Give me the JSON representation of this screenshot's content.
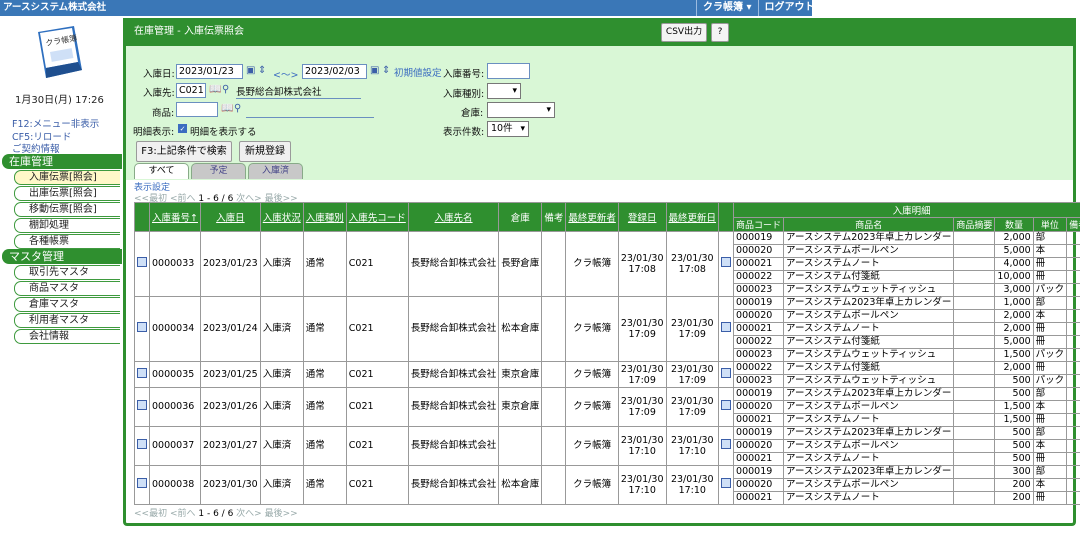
{
  "company": "アースシステム株式会社",
  "topmenu": [
    "クラ帳簿 ▾",
    "ログアウト"
  ],
  "logo_text": "クラ帳簿",
  "date": "1月30日(月) 17:26",
  "side_links": [
    "F12:メニュー非表示",
    "CF5:リロード",
    "ご契約情報"
  ],
  "sections": [
    {
      "label": "在庫管理",
      "items": [
        "入庫伝票[照会]",
        "出庫伝票[照会]",
        "移動伝票[照会]",
        "棚卸処理",
        "各種帳票"
      ]
    },
    {
      "label": "マスタ管理",
      "items": [
        "取引先マスタ",
        "商品マスタ",
        "倉庫マスタ",
        "利用者マスタ",
        "会社情報"
      ]
    }
  ],
  "panel": {
    "title": "在庫管理 - 入庫伝票照会",
    "csv": "CSV出力",
    "help": "?"
  },
  "form": {
    "date_label": "入庫日:",
    "date_from": "2023/01/23",
    "tilde": "<～>",
    "date_to": "2023/02/03",
    "init": "初期値設定",
    "slip_label": "入庫番号:",
    "supplier_label": "入庫先:",
    "supplier_code": "C021",
    "supplier_name": "長野総合卸株式会社",
    "type_label": "入庫種別:",
    "item_label": "商品:",
    "wh_label": "倉庫:",
    "detail_label": "明細表示:",
    "detail_check": "明細を表示する",
    "count_label": "表示件数:",
    "count_value": "10件",
    "search_btn": "F3:上記条件で検索",
    "new_btn": "新規登録"
  },
  "tabs": [
    "すべて",
    "予定",
    "入庫済"
  ],
  "showset": "表示設定",
  "pager": {
    "first": "<<最初",
    "prev": "<前へ",
    "range": "1 - 6 / 6",
    "next": "次へ>",
    "last": "最後>>"
  },
  "headers": [
    "入庫番号↑",
    "入庫日",
    "入庫状況",
    "入庫種別",
    "入庫先コード",
    "入庫先名",
    "倉庫",
    "備考",
    "最終更新者",
    "登録日",
    "最終更新日"
  ],
  "detail_header": "入庫明細",
  "detail_cols": [
    "商品コード",
    "商品名",
    "商品摘要",
    "数量",
    "単位",
    "備考"
  ],
  "rows": [
    {
      "no": "0000033",
      "date": "2023/01/23",
      "status": "入庫済",
      "type": "通常",
      "code": "C021",
      "name": "長野総合卸株式会社",
      "wh": "長野倉庫",
      "user": "クラ帳簿",
      "reg": "23/01/30 17:08",
      "upd": "23/01/30 17:08",
      "items": [
        [
          "000019",
          "アースシステム2023年卓上カレンダー",
          "2,000",
          "部"
        ],
        [
          "000020",
          "アースシステムボールペン",
          "5,000",
          "本"
        ],
        [
          "000021",
          "アースシステムノート",
          "4,000",
          "冊"
        ],
        [
          "000022",
          "アースシステム付箋紙",
          "10,000",
          "冊"
        ],
        [
          "000023",
          "アースシステムウェットティッシュ",
          "3,000",
          "パック"
        ]
      ]
    },
    {
      "no": "0000034",
      "date": "2023/01/24",
      "status": "入庫済",
      "type": "通常",
      "code": "C021",
      "name": "長野総合卸株式会社",
      "wh": "松本倉庫",
      "user": "クラ帳簿",
      "reg": "23/01/30 17:09",
      "upd": "23/01/30 17:09",
      "items": [
        [
          "000019",
          "アースシステム2023年卓上カレンダー",
          "1,000",
          "部"
        ],
        [
          "000020",
          "アースシステムボールペン",
          "2,000",
          "本"
        ],
        [
          "000021",
          "アースシステムノート",
          "2,000",
          "冊"
        ],
        [
          "000022",
          "アースシステム付箋紙",
          "5,000",
          "冊"
        ],
        [
          "000023",
          "アースシステムウェットティッシュ",
          "1,500",
          "パック"
        ]
      ]
    },
    {
      "no": "0000035",
      "date": "2023/01/25",
      "status": "入庫済",
      "type": "通常",
      "code": "C021",
      "name": "長野総合卸株式会社",
      "wh": "東京倉庫",
      "user": "クラ帳簿",
      "reg": "23/01/30 17:09",
      "upd": "23/01/30 17:09",
      "items": [
        [
          "000022",
          "アースシステム付箋紙",
          "2,000",
          "冊"
        ],
        [
          "000023",
          "アースシステムウェットティッシュ",
          "500",
          "パック"
        ]
      ]
    },
    {
      "no": "0000036",
      "date": "2023/01/26",
      "status": "入庫済",
      "type": "通常",
      "code": "C021",
      "name": "長野総合卸株式会社",
      "wh": "東京倉庫",
      "user": "クラ帳簿",
      "reg": "23/01/30 17:09",
      "upd": "23/01/30 17:09",
      "items": [
        [
          "000019",
          "アースシステム2023年卓上カレンダー",
          "500",
          "部"
        ],
        [
          "000020",
          "アースシステムボールペン",
          "1,500",
          "本"
        ],
        [
          "000021",
          "アースシステムノート",
          "1,500",
          "冊"
        ]
      ]
    },
    {
      "no": "0000037",
      "date": "2023/01/27",
      "status": "入庫済",
      "type": "通常",
      "code": "C021",
      "name": "長野総合卸株式会社",
      "wh": "",
      "user": "クラ帳簿",
      "reg": "23/01/30 17:10",
      "upd": "23/01/30 17:10",
      "items": [
        [
          "000019",
          "アースシステム2023年卓上カレンダー",
          "500",
          "部"
        ],
        [
          "000020",
          "アースシステムボールペン",
          "500",
          "本"
        ],
        [
          "000021",
          "アースシステムノート",
          "500",
          "冊"
        ]
      ]
    },
    {
      "no": "0000038",
      "date": "2023/01/30",
      "status": "入庫済",
      "type": "通常",
      "code": "C021",
      "name": "長野総合卸株式会社",
      "wh": "松本倉庫",
      "user": "クラ帳簿",
      "reg": "23/01/30 17:10",
      "upd": "23/01/30 17:10",
      "items": [
        [
          "000019",
          "アースシステム2023年卓上カレンダー",
          "300",
          "部"
        ],
        [
          "000020",
          "アースシステムボールペン",
          "200",
          "本"
        ],
        [
          "000021",
          "アースシステムノート",
          "200",
          "冊"
        ]
      ]
    }
  ]
}
